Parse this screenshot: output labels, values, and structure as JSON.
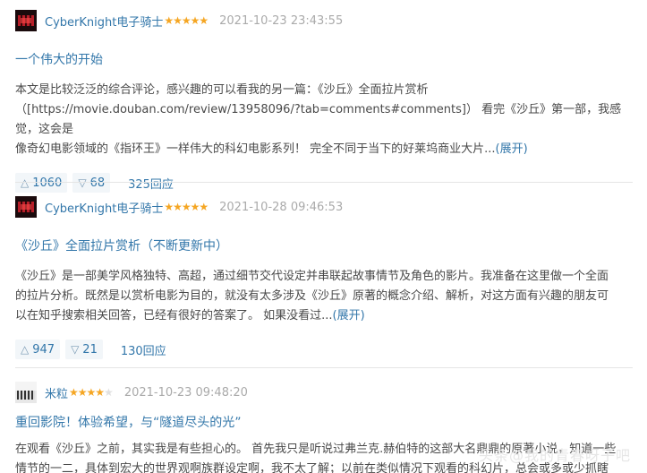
{
  "reviews": [
    {
      "author": "CyberKnight电子骑士",
      "stars": "★★★★★",
      "stars_off": "",
      "date": "2021-10-23 23:43:55",
      "title": "一个伟大的开始",
      "body_lines": [
        "本文是比较泛泛的综合评论，感兴趣的可以看我的另一篇：《沙丘》全面拉片赏析",
        "（[https://movie.douban.com/review/13958096/?tab=comments#comments]） 看完《沙丘》第一部，我感觉，这会是",
        "像奇幻电影领域的《指环王》一样伟大的科幻电影系列！ 完全不同于当下的好莱坞商业大片..."
      ],
      "more": "(展开)",
      "useful": "1060",
      "useless": "68",
      "replies": "325回应"
    },
    {
      "author": "CyberKnight电子骑士",
      "stars": "★★★★★",
      "stars_off": "",
      "date": "2021-10-28 09:46:53",
      "title": "《沙丘》全面拉片赏析（不断更新中）",
      "body_lines": [
        "《沙丘》是一部美学风格独特、高超，通过细节交代设定并串联起故事情节及角色的影片。我准备在这里做一个全面",
        "的拉片分析。既然是以赏析电影为目的，就没有太多涉及《沙丘》原著的概念介绍、解析，对这方面有兴趣的朋友可",
        "以在知乎搜索相关回答，已经有很好的答案了。 如果没看过..."
      ],
      "more": "(展开)",
      "useful": "947",
      "useless": "21",
      "replies": "130回应"
    },
    {
      "author": "米粒",
      "stars": "★★★★",
      "stars_off": "★",
      "date": "2021-10-23 09:48:20",
      "title": "重回影院！体验希望，与“隧道尽头的光”",
      "body_lines": [
        "在观看《沙丘》之前，其实我是有些担心的。 首先我只是听说过弗兰克.赫伯特的这部大名鼎鼎的原著小说，知道一些",
        "情节的一二，具体到宏大的世界观啊族群设定啊，我不太了解；以前在类似情况下观看的科幻片，总会或多或少抓瞎"
      ],
      "more": "",
      "useful": "",
      "useless": "",
      "replies": ""
    }
  ],
  "watermark": "头条@我的青春呀子吧",
  "icons": {
    "useful": "triangle-up-icon",
    "useless": "triangle-down-icon"
  },
  "colors": {
    "link": "#3377aa",
    "star": "#f5a623",
    "date": "#aaaaaa",
    "text": "#494949",
    "vote_bg": "#f2f6f9"
  }
}
